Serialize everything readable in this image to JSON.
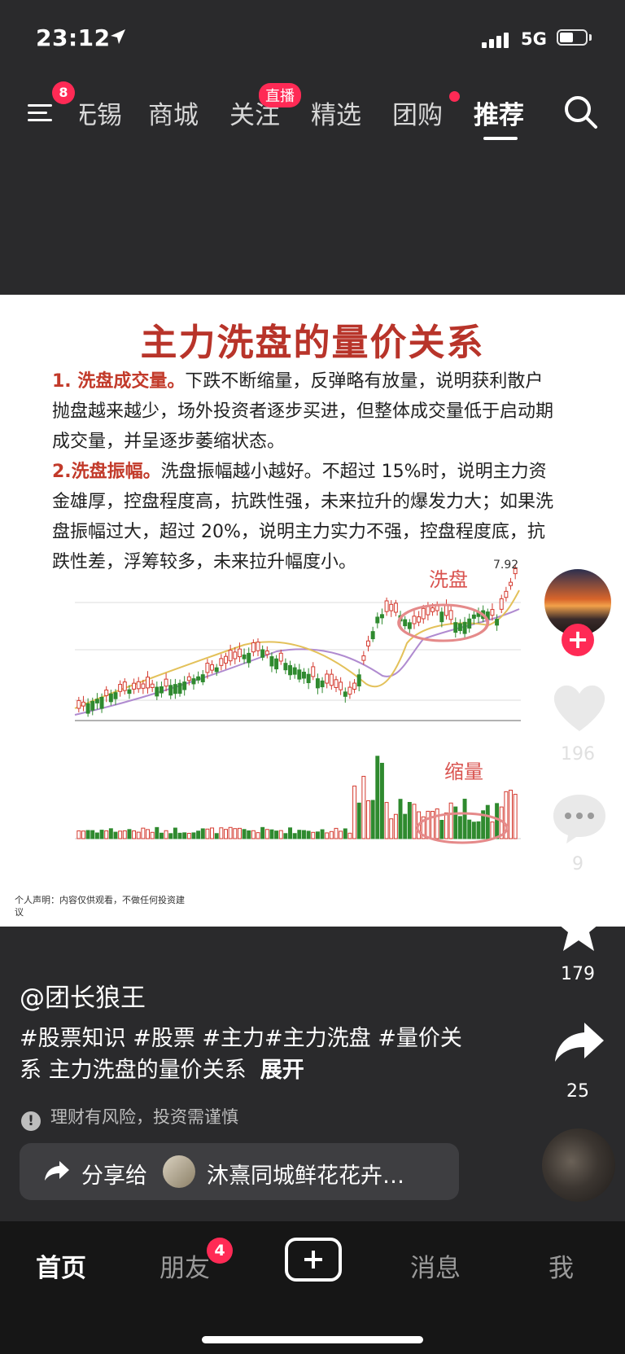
{
  "status": {
    "time": "23:12",
    "network": "5G"
  },
  "topnav": {
    "menu_badge": "8",
    "tabs": [
      {
        "label": "无锡"
      },
      {
        "label": "商城"
      },
      {
        "label": "关注",
        "badge": "直播"
      },
      {
        "label": "精选"
      },
      {
        "label": "团购"
      },
      {
        "label": "推荐",
        "active": true
      }
    ]
  },
  "video": {
    "title": "主力洗盘的量价关系",
    "p1_head": "1. 洗盘成交量。",
    "p1_body": "下跌不断缩量，反弹略有放量，说明获利散户抛盘越来越少，场外投资者逐步买进，但整体成交量低于启动期成交量，并呈逐步萎缩状态。",
    "p2_head": "2.洗盘振幅。",
    "p2_body": "洗盘振幅越小越好。不超过 15%时，说明主力资金雄厚，控盘程度高，抗跌性强，未来拉升的爆发力大；如果洗盘振幅过大，超过 20%，说明主力实力不强，控盘程度底，抗跌性差，浮筹较多，未来拉升幅度小。",
    "chart_label_wash": "洗盘",
    "chart_label_shrink": "缩量",
    "chart_price_label": "7.92",
    "disclaimer": "个人声明：内容仅供观看，不做任何投资建议"
  },
  "rail": {
    "likes": "196",
    "comments": "9",
    "favorites": "179",
    "shares": "25"
  },
  "post": {
    "author": "@团长狼王",
    "description": "#股票知识 #股票 #主力#主力洗盘 #量价关系 主力洗盘的量价关系",
    "expand": "展开",
    "risk_notice": "理财有风险，投资需谨慎",
    "share_label": "分享给",
    "share_target": "沐熹同城鲜花花卉…"
  },
  "bottom_nav": {
    "home": "首页",
    "friends": "朋友",
    "friends_badge": "4",
    "messages": "消息",
    "me": "我"
  },
  "colors": {
    "accent": "#ff2a55",
    "title_red": "#b8342a",
    "bull": "#d43a2f",
    "bear": "#2f8a2f"
  }
}
